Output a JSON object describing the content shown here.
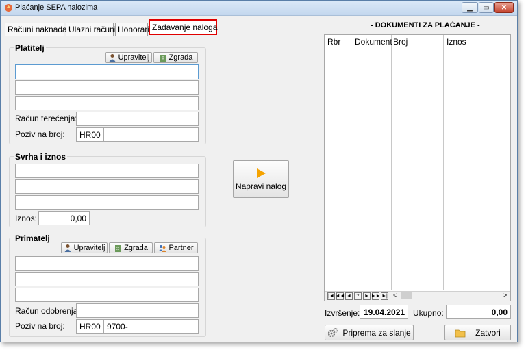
{
  "window": {
    "title": "Plaćanje SEPA nalozima"
  },
  "tabs": [
    {
      "label": "Računi naknada"
    },
    {
      "label": "Ulazni računi"
    },
    {
      "label": "Honorari"
    },
    {
      "label": "Zadavanje naloga",
      "active": true
    }
  ],
  "platitelj": {
    "title": "Platitelj",
    "btn_upravitelj": "Upravitelj",
    "btn_zgrada": "Zgrada",
    "racun_label": "Račun terećenja:",
    "poziv_label": "Poziv na broj:",
    "poziv_model": "HR00",
    "poziv_value": ""
  },
  "svrha": {
    "title": "Svrha i iznos",
    "iznos_label": "Iznos:",
    "iznos_value": "0,00"
  },
  "napravi": {
    "label": "Napravi nalog"
  },
  "primatelj": {
    "title": "Primatelj",
    "btn_upravitelj": "Upravitelj",
    "btn_zgrada": "Zgrada",
    "btn_partner": "Partner",
    "racun_label": "Račun odobrenja:",
    "poziv_label": "Poziv na broj:",
    "poziv_model": "HR00",
    "poziv_value": "9700-"
  },
  "dokumenti": {
    "title": "- DOKUMENTI ZA PLAĆANJE -",
    "columns": [
      "Rbr",
      "Dokument",
      "Broj",
      "Iznos"
    ],
    "rows": [],
    "nav": [
      "|◄",
      "◄◄",
      "◄",
      "?",
      "►",
      "►►",
      "►|"
    ]
  },
  "footer": {
    "izvrsenje_label": "Izvršenje:",
    "izvrsenje_value": "19.04.2021",
    "ukupno_label": "Ukupno:",
    "ukupno_value": "0,00",
    "priprema_label": "Priprema za slanje",
    "zatvori_label": "Zatvori"
  },
  "icons": {
    "app": "sepa-app-icon",
    "upravitelj": "person-icon",
    "zgrada": "building-icon",
    "partner": "partners-icon",
    "napravi": "play-arrow-icon",
    "priprema": "gears-icon",
    "zatvori": "folder-icon"
  },
  "colors": {
    "active_tab_border": "#e00000",
    "arrow": "#f5a300"
  }
}
